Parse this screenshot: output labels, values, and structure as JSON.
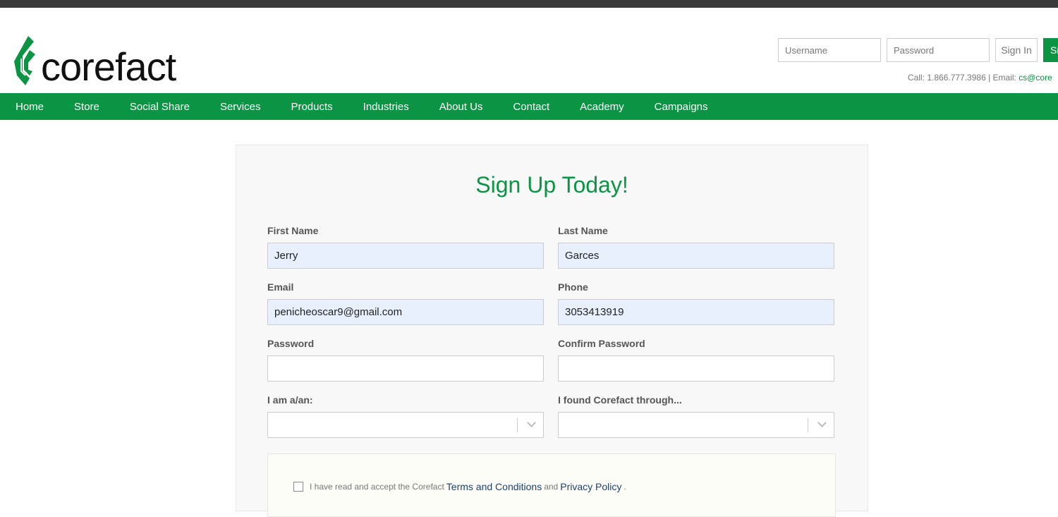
{
  "brand": {
    "name": "corefact",
    "color": "#0b9444"
  },
  "login": {
    "username_placeholder": "Username",
    "password_placeholder": "Password",
    "signin_label": "Sign In",
    "signup_label": "Si"
  },
  "contact": {
    "call": "Call: 1.866.777.3986 | Email: ",
    "email": "cs@core"
  },
  "nav": [
    "Home",
    "Store",
    "Social Share",
    "Services",
    "Products",
    "Industries",
    "About Us",
    "Contact",
    "Academy",
    "Campaigns"
  ],
  "form": {
    "title": "Sign Up Today!",
    "first_name": {
      "label": "First Name",
      "value": "Jerry"
    },
    "last_name": {
      "label": "Last Name",
      "value": "Garces"
    },
    "email": {
      "label": "Email",
      "value": "penicheoscar9@gmail.com"
    },
    "phone": {
      "label": "Phone",
      "value": "3053413919"
    },
    "password": {
      "label": "Password",
      "value": ""
    },
    "confirm_password": {
      "label": "Confirm Password",
      "value": ""
    },
    "i_am": {
      "label": "I am a/an:",
      "value": ""
    },
    "found_through": {
      "label": "I found Corefact through...",
      "value": ""
    },
    "terms": {
      "text": "I have read and accept the Corefact",
      "terms_link": "Terms and Conditions",
      "and": "and",
      "privacy_link": "Privacy Policy",
      "period": ".",
      "checked": false
    }
  }
}
